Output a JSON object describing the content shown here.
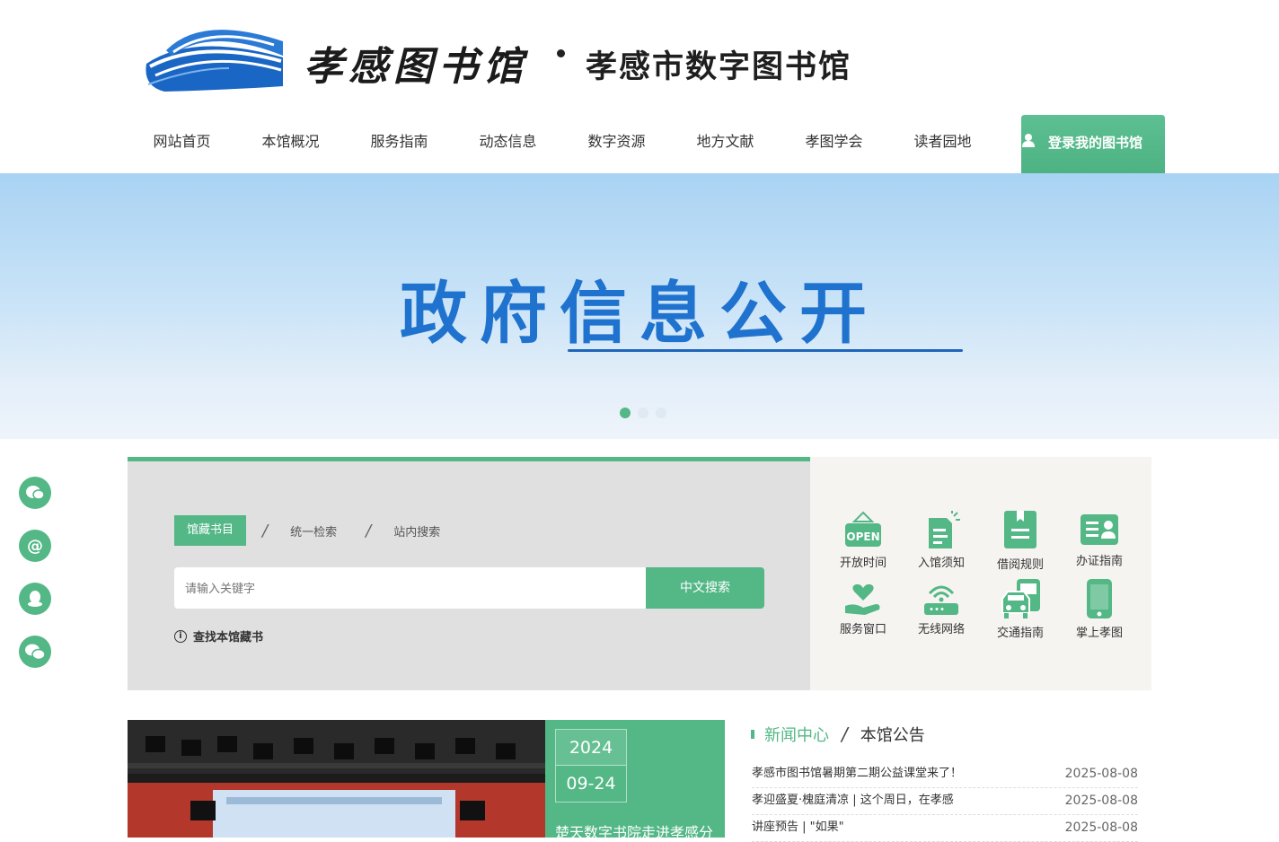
{
  "header": {
    "brand_calligraphy": "孝感图书馆",
    "brand_title": "孝感市数字图书馆"
  },
  "nav": {
    "items": [
      "网站首页",
      "本馆概况",
      "服务指南",
      "动态信息",
      "数字资源",
      "地方文献",
      "孝图学会",
      "读者园地"
    ],
    "login_label": "登录我的图书馆"
  },
  "banner": {
    "title": "政府信息公开",
    "slides": 3,
    "active_slide": 1
  },
  "search": {
    "tabs": [
      "馆藏书目",
      "统一检索",
      "站内搜索"
    ],
    "active_tab": "馆藏书目",
    "placeholder": "请输入关键字",
    "button_label": "中文搜索",
    "hint": "查找本馆藏书"
  },
  "services": {
    "items": [
      {
        "label": "开放时间",
        "icon": "open-sign-icon"
      },
      {
        "label": "入馆须知",
        "icon": "notice-doc-icon"
      },
      {
        "label": "借阅规则",
        "icon": "book-rules-icon"
      },
      {
        "label": "办证指南",
        "icon": "id-card-icon"
      },
      {
        "label": "服务窗口",
        "icon": "heart-hand-icon"
      },
      {
        "label": "无线网络",
        "icon": "wifi-router-icon"
      },
      {
        "label": "交通指南",
        "icon": "bus-car-icon"
      },
      {
        "label": "掌上孝图",
        "icon": "mobile-phone-icon"
      }
    ]
  },
  "news": {
    "tabs": [
      "新闻中心",
      "本馆公告"
    ],
    "active_tab": "新闻中心",
    "featured": {
      "year": "2024",
      "month_day": "09-24",
      "headline": "楚天数字书院走进孝感分"
    },
    "items": [
      {
        "title": "孝感市图书馆暑期第二期公益课堂来了！",
        "date": "2025-08-08"
      },
      {
        "title": "孝迎盛夏·槐庭清凉 | 这个周日，在孝感",
        "date": "2025-08-08"
      },
      {
        "title": "讲座预告 | \"如果\"",
        "date": "2025-08-08"
      }
    ]
  },
  "colors": {
    "accent": "#53b786",
    "banner_text": "#1f73cf",
    "logo_blue": "#1a66c4"
  }
}
